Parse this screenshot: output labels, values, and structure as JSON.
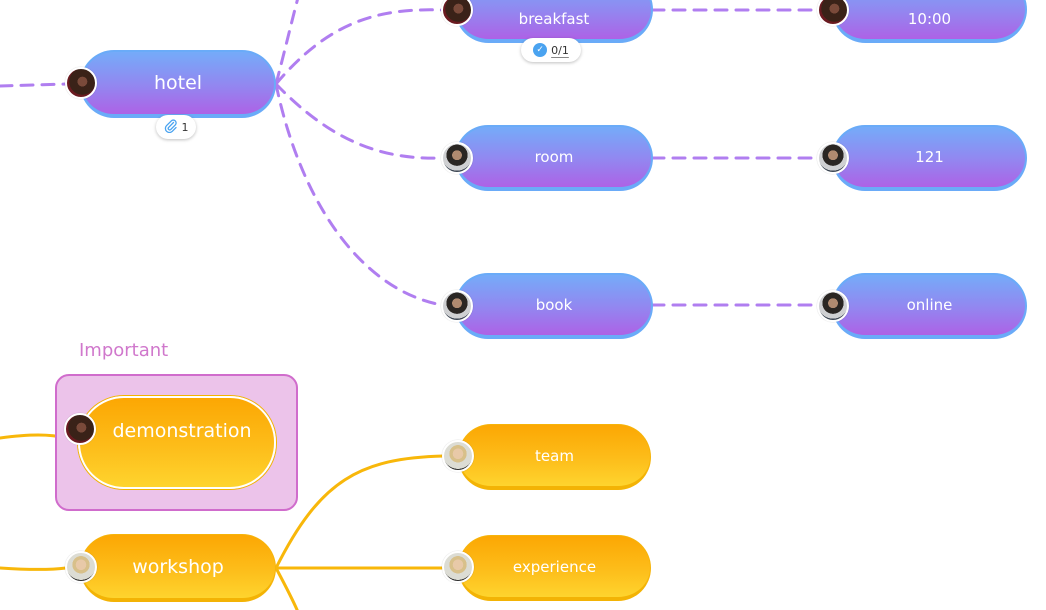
{
  "mindmap": {
    "colors": {
      "purple_link": "#b07ef0",
      "orange_link": "#f8b70a",
      "purple_gradient_top": "#75abf9",
      "purple_gradient_bottom": "#ad62e6",
      "orange_gradient_top": "#fca703",
      "orange_gradient_bottom": "#fed42e",
      "frame_fill": "#ecc3ea",
      "frame_border": "#d06ccc"
    },
    "nodes": {
      "hotel": {
        "label": "hotel",
        "avatar": "woman-dark",
        "attachment_count": "1",
        "attachment_icon": "paperclip-icon"
      },
      "breakfast": {
        "label": "breakfast",
        "avatar": "woman-dark",
        "checklist": "0/1",
        "checklist_icon": "check-circle-icon"
      },
      "time": {
        "label": "10:00",
        "avatar": "woman-dark"
      },
      "room": {
        "label": "room",
        "avatar": "man-beard"
      },
      "room_number": {
        "label": "121",
        "avatar": "man-beard"
      },
      "book": {
        "label": "book",
        "avatar": "man-beard"
      },
      "online": {
        "label": "online",
        "avatar": "man-beard"
      },
      "demonstration": {
        "label": "demonstration",
        "avatar": "woman-dark"
      },
      "workshop": {
        "label": "workshop",
        "avatar": "woman-glasses"
      },
      "team": {
        "label": "team",
        "avatar": "woman-glasses"
      },
      "experience": {
        "label": "experience",
        "avatar": "woman-glasses"
      }
    },
    "frame": {
      "label": "Important"
    },
    "icons": {
      "check": "✓",
      "clip": "🖇"
    }
  }
}
